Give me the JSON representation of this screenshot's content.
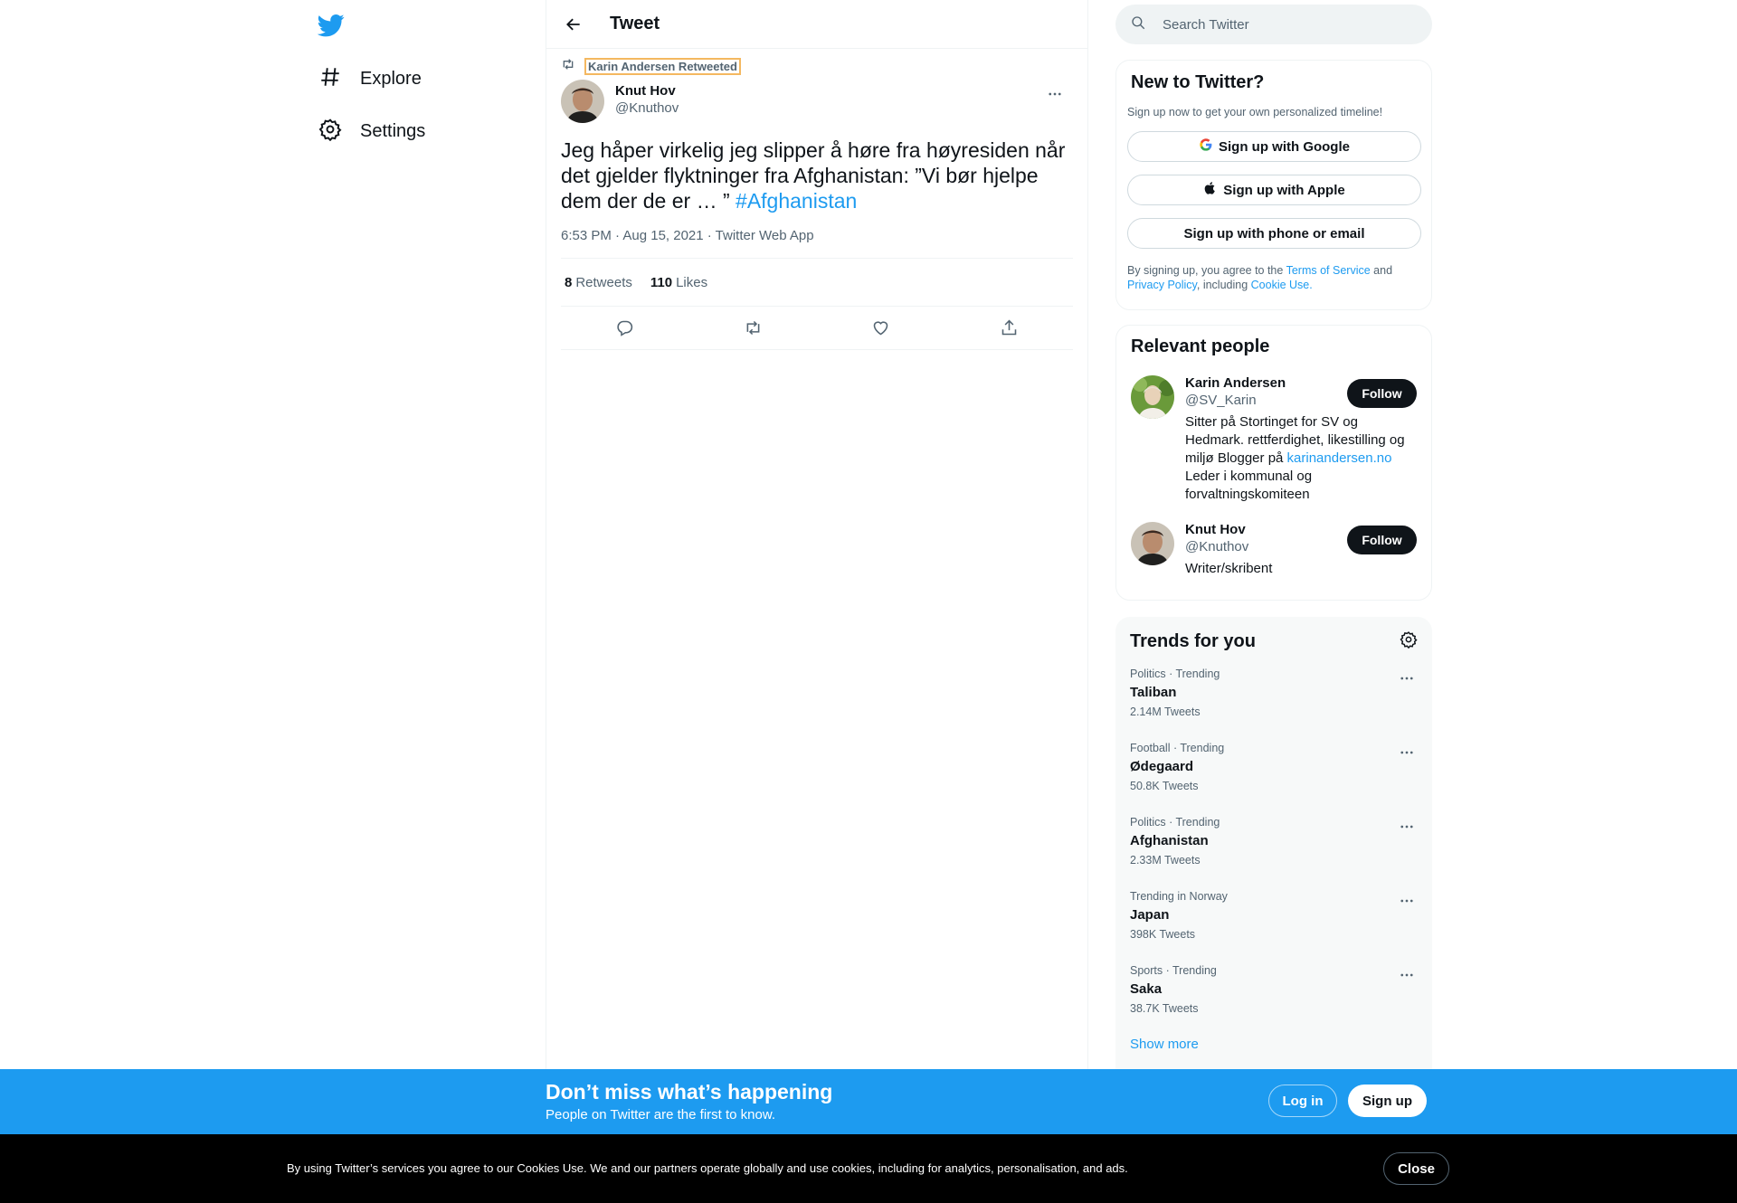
{
  "nav": {
    "items": [
      {
        "label": "Explore"
      },
      {
        "label": "Settings"
      }
    ]
  },
  "header": {
    "title": "Tweet"
  },
  "tweet": {
    "retweeted_by": "Karin Andersen Retweeted",
    "author_name": "Knut Hov",
    "author_handle": "@Knuthov",
    "text": "Jeg håper virkelig jeg slipper å høre fra høyresiden når det gjelder flyktninger fra Afghanistan: ”Vi bør hjelpe dem der de er … ” ",
    "hashtag": "#Afghanistan",
    "timestamp": "6:53 PM · Aug 15, 2021 · Twitter Web App",
    "retweets_count": "8",
    "retweets_label": "Retweets",
    "likes_count": "110",
    "likes_label": "Likes"
  },
  "search": {
    "placeholder": "Search Twitter"
  },
  "signup": {
    "title": "New to Twitter?",
    "subtitle": "Sign up now to get your own personalized timeline!",
    "google": "Sign up with Google",
    "apple": "Sign up with Apple",
    "phone": "Sign up with phone or email",
    "terms_pre": "By signing up, you agree to the ",
    "terms_link": "Terms of Service",
    "terms_and": " and ",
    "privacy_link": "Privacy Policy",
    "terms_including": ", including ",
    "cookie_link": "Cookie Use."
  },
  "people": {
    "title": "Relevant people",
    "follow_label": "Follow",
    "list": [
      {
        "name": "Karin Andersen",
        "handle": "@SV_Karin",
        "bio_pre": "Sitter på Stortinget for SV og Hedmark. rettferdighet, likestilling og miljø Blogger på ",
        "bio_link": "karinandersen.no",
        "bio_post": " Leder i kommunal og forvaltningskomiteen"
      },
      {
        "name": "Knut Hov",
        "handle": "@Knuthov",
        "bio_pre": "Writer/skribent",
        "bio_link": "",
        "bio_post": ""
      }
    ]
  },
  "trends": {
    "title": "Trends for you",
    "items": [
      {
        "category": "Politics · Trending",
        "name": "Taliban",
        "count": "2.14M Tweets"
      },
      {
        "category": "Football · Trending",
        "name": "Ødegaard",
        "count": "50.8K Tweets"
      },
      {
        "category": "Politics · Trending",
        "name": "Afghanistan",
        "count": "2.33M Tweets"
      },
      {
        "category": "Trending in Norway",
        "name": "Japan",
        "count": "398K Tweets"
      },
      {
        "category": "Sports · Trending",
        "name": "Saka",
        "count": "38.7K Tweets"
      }
    ],
    "show_more": "Show more"
  },
  "banner": {
    "title": "Don’t miss what’s happening",
    "subtitle": "People on Twitter are the first to know.",
    "login": "Log in",
    "signup": "Sign up"
  },
  "cookie": {
    "text": "By using Twitter’s services you agree to our Cookies Use. We and our partners operate globally and use cookies, including for analytics, personalisation, and ads.",
    "close": "Close"
  },
  "colors": {
    "accent": "#1d9bf0",
    "text": "#0f1419",
    "secondary": "#536471"
  }
}
